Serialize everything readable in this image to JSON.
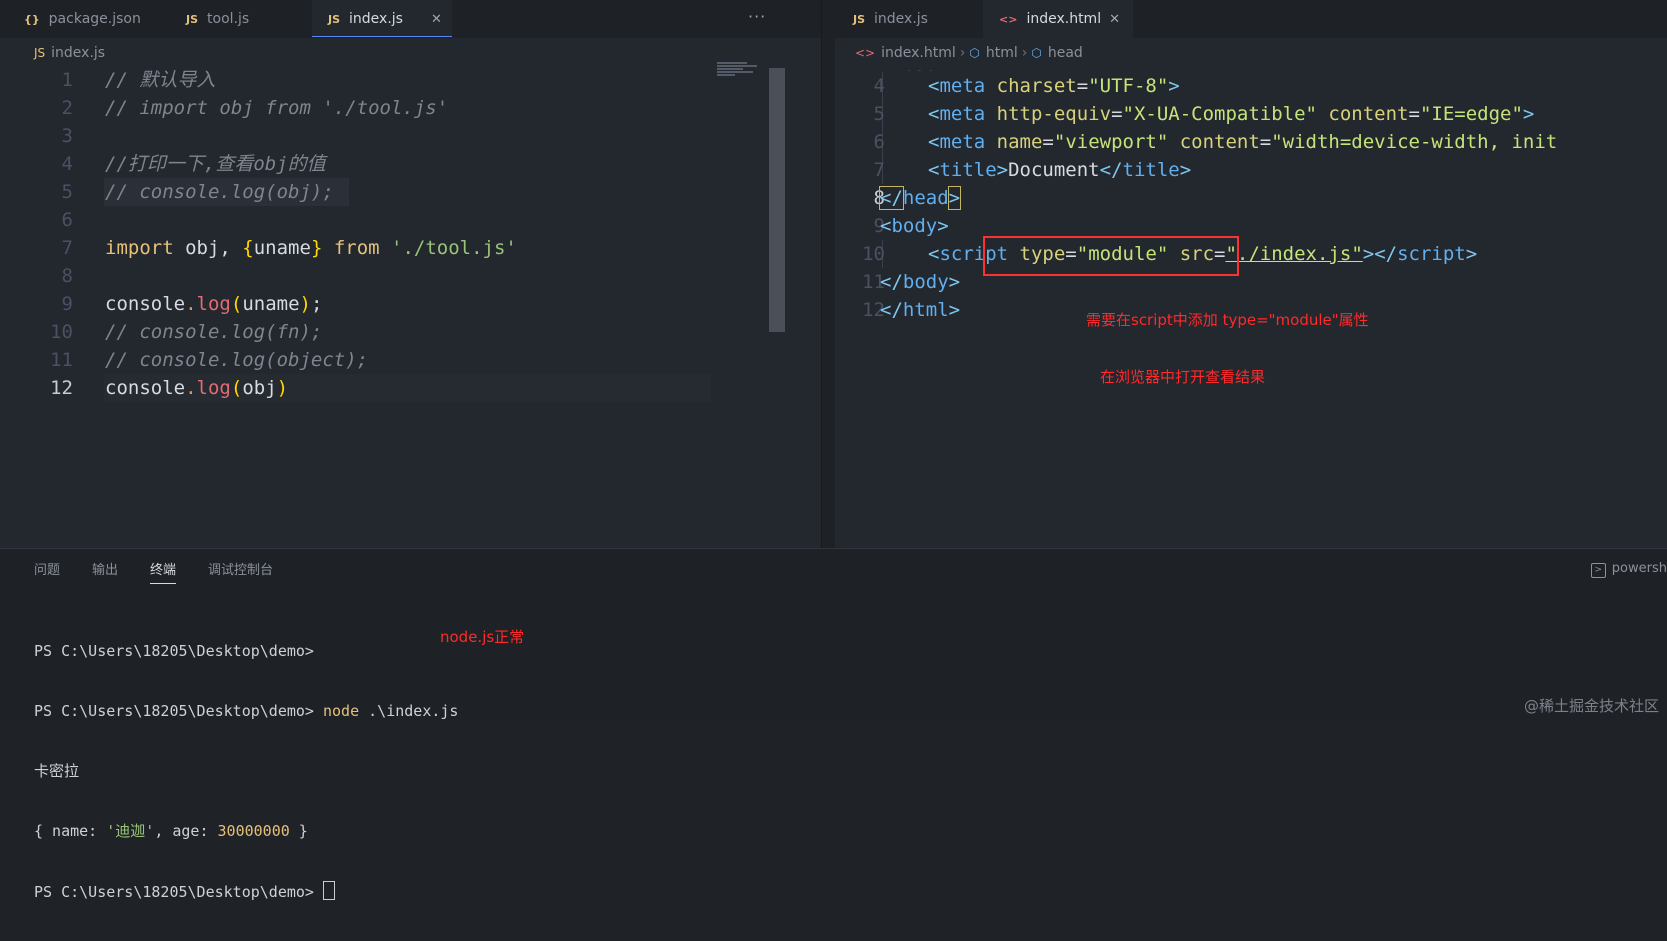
{
  "left_editor": {
    "tabs": [
      {
        "icon_text": "{}",
        "label": "package.json"
      },
      {
        "icon_text": "JS",
        "label": "tool.js"
      },
      {
        "icon_text": "JS",
        "label": "index.js",
        "close": "✕"
      }
    ],
    "more_label": "···",
    "breadcrumb": {
      "icon_text": "JS",
      "file": "index.js"
    },
    "line_numbers": [
      "1",
      "2",
      "3",
      "4",
      "5",
      "6",
      "7",
      "8",
      "9",
      "10",
      "11",
      "12"
    ],
    "code": {
      "l1": "// 默认导入",
      "l2": "// import obj from './tool.js'",
      "l4": "//打印一下,查看obj的值",
      "l5": "// console.log(obj);",
      "l7_import": "import",
      "l7_obj": " obj, ",
      "l7_open": "{",
      "l7_uname": "uname",
      "l7_close": "}",
      "l7_from": " from ",
      "l7_str": "'./tool.js'",
      "l9_console": "console",
      "l9_dot": ".",
      "l9_log": "log",
      "l9_open": "(",
      "l9_arg": "uname",
      "l9_close": ")",
      "l9_semi": ";",
      "l10": "// console.log(fn);",
      "l11": "// console.log(object);",
      "l12_console": "console",
      "l12_dot": ".",
      "l12_log": "log",
      "l12_open": "(",
      "l12_arg": "obj",
      "l12_close": ")"
    }
  },
  "right_editor": {
    "tabs": [
      {
        "icon_text": "JS",
        "label": "index.js"
      },
      {
        "icon_text": "<>",
        "label": "index.html",
        "close": "✕"
      }
    ],
    "breadcrumb": {
      "file_icon": "<>",
      "file": "index.html",
      "sep": "›",
      "node_icon": "⬡",
      "node1": "html",
      "node2": "head"
    },
    "line_numbers": [
      "4",
      "5",
      "6",
      "7",
      "8",
      "9",
      "10",
      "11",
      "12"
    ],
    "partial_line": "<head>",
    "code": {
      "l4": {
        "open": "<",
        "tag": "meta",
        "a1": " charset",
        "eq": "=",
        "v1": "\"UTF-8\"",
        "close": ">"
      },
      "l5": {
        "open": "<",
        "tag": "meta",
        "a1": " http-equiv",
        "eq": "=",
        "v1": "\"X-UA-Compatible\"",
        "a2": " content",
        "v2": "\"IE=edge\"",
        "close": ">"
      },
      "l6": {
        "open": "<",
        "tag": "meta",
        "a1": " name",
        "eq": "=",
        "v1": "\"viewport\"",
        "a2": " content",
        "v2": "\"width=device-width, init"
      },
      "l7": {
        "open": "<",
        "tag": "title",
        "close": ">",
        "text": "Document",
        "end_open": "</",
        "end_close": ">"
      },
      "l8": {
        "open": "</",
        "tag": "head",
        "close": ">"
      },
      "l9": {
        "open": "<",
        "tag": "body",
        "close": ">"
      },
      "l10": {
        "open": "<",
        "tag": "script",
        "a1": " type",
        "eq": "=",
        "v1": "\"module\"",
        "a2": " src",
        "v2": "\"./index.js\"",
        "close": ">",
        "end_open": "</",
        "end_tag": "script",
        "end_close": ">"
      },
      "l11": {
        "open": "</",
        "tag": "body",
        "close": ">"
      },
      "l12": {
        "open": "</",
        "tag": "html",
        "close": ">"
      }
    }
  },
  "annotations": {
    "script_note": "需要在script中添加 type=\"module\"属性",
    "browser_note": "在浏览器中打开查看结果",
    "node_note": "node.js正常"
  },
  "panel": {
    "tabs": [
      "问题",
      "输出",
      "终端",
      "调试控制台"
    ],
    "active_tab": "终端",
    "shell_label": "powersh",
    "terminal": {
      "line1": "PS C:\\Users\\18205\\Desktop\\demo> ",
      "line2_prompt": "PS C:\\Users\\18205\\Desktop\\demo> ",
      "line2_cmd": "node",
      "line2_arg": " .\\index.js",
      "line3": "卡密拉",
      "line4_a": "{ name: ",
      "line4_str": "'迪迦'",
      "line4_b": ", age: ",
      "line4_num": "30000000",
      "line4_c": " }",
      "line5": "PS C:\\Users\\18205\\Desktop\\demo> "
    }
  },
  "watermark": "@稀土掘金技术社区",
  "colors": {
    "annotation": "#ff2a2a",
    "accent_tab": "#568af2"
  }
}
